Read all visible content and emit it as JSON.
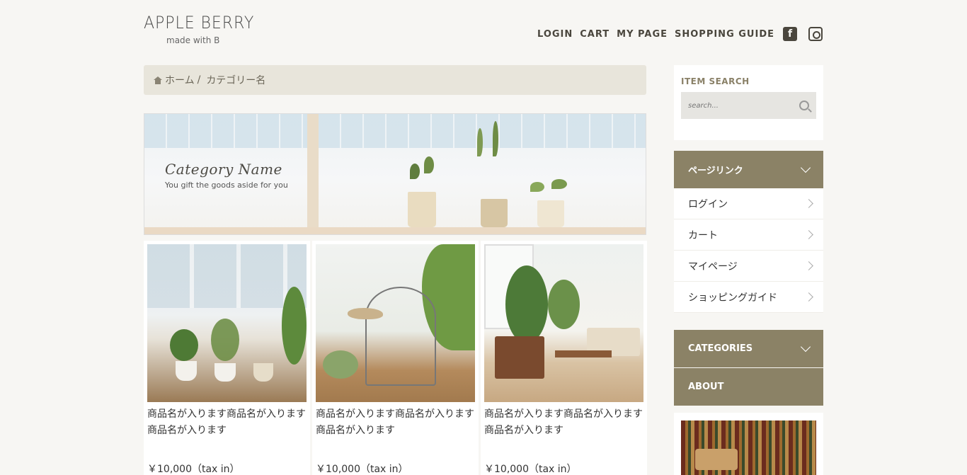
{
  "logo": {
    "title": "APPLE BERRY",
    "subtitle": "made with B"
  },
  "nav": {
    "items": [
      {
        "label": "LOGIN"
      },
      {
        "label": "CART"
      },
      {
        "label": "MY PAGE"
      },
      {
        "label": "SHOPPING GUIDE"
      }
    ],
    "icons": [
      "facebook-icon",
      "instagram-icon"
    ]
  },
  "breadcrumb": {
    "home": "ホーム",
    "separator": "/",
    "current": "カテゴリー名"
  },
  "hero": {
    "title": "Category Name",
    "subtitle": "You gift the goods aside for you"
  },
  "products": [
    {
      "name": "商品名が入ります商品名が入ります商品名が入ります",
      "price": "￥10,000（tax in）"
    },
    {
      "name": "商品名が入ります商品名が入ります商品名が入ります",
      "price": "￥10,000（tax in）"
    },
    {
      "name": "商品名が入ります商品名が入ります商品名が入ります",
      "price": "￥10,000（tax in）"
    }
  ],
  "sidebar": {
    "search_heading": "ITEM SEARCH",
    "search_placeholder": "search...",
    "page_links_heading": "ページリンク",
    "page_links": [
      {
        "label": "ログイン"
      },
      {
        "label": "カート"
      },
      {
        "label": "マイページ"
      },
      {
        "label": "ショッピングガイド"
      }
    ],
    "categories_heading": "CATEGORIES",
    "about_heading": "ABOUT"
  },
  "colors": {
    "accent": "#8b8266",
    "background": "#f7f6f3",
    "breadcrumb_bg": "#e8e5db"
  }
}
